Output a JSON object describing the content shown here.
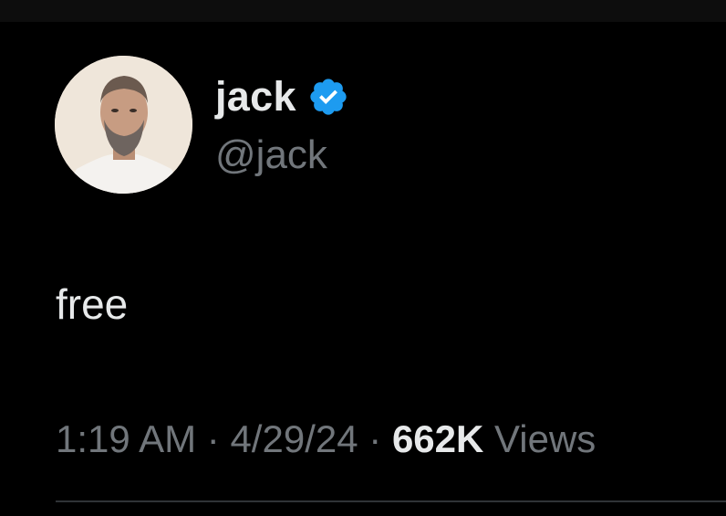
{
  "colors": {
    "background": "#000000",
    "primary_text": "#e7e9ea",
    "secondary_text": "#71767b",
    "verified_badge": "#1d9bf0",
    "divider": "#2f3336"
  },
  "author": {
    "display_name": "jack",
    "handle": "@jack",
    "verified": true,
    "verified_icon": "verified-badge-icon"
  },
  "tweet": {
    "text": "free",
    "time": "1:19 AM",
    "separator": "·",
    "date": "4/29/24",
    "views_count": "662K",
    "views_label": "Views"
  }
}
